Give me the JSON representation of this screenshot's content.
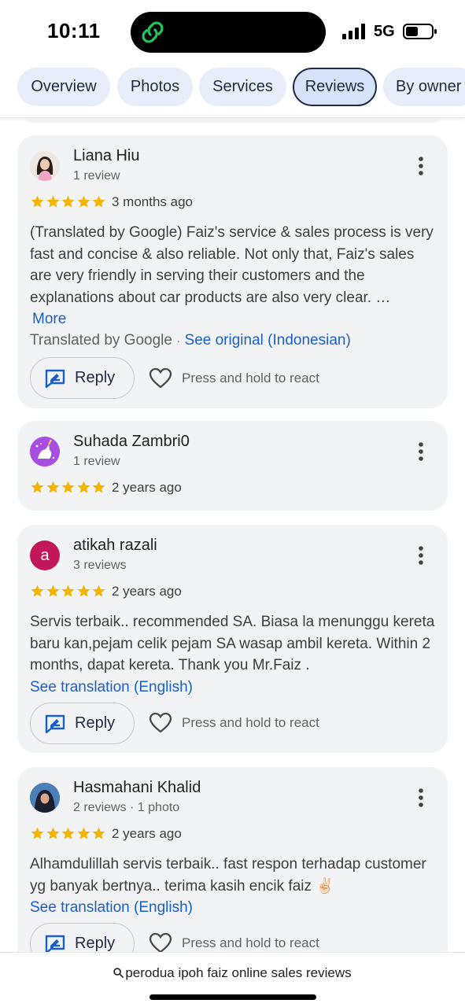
{
  "status_bar": {
    "time": "10:11",
    "network": "5G"
  },
  "tabs": [
    {
      "label": "Overview",
      "active": false
    },
    {
      "label": "Photos",
      "active": false
    },
    {
      "label": "Services",
      "active": false
    },
    {
      "label": "Reviews",
      "active": true
    },
    {
      "label": "By owner",
      "active": false
    }
  ],
  "common": {
    "reply_label": "Reply",
    "react_hint": "Press and hold to react",
    "star_color": "#f4b400",
    "link_color": "#1a5fc7"
  },
  "reviews": [
    {
      "name": "Liana Hiu",
      "meta": "1 review",
      "rating": 5,
      "time_ago": "3 months ago",
      "text": "(Translated by Google) Faiz's service & sales process is very fast and concise & also reliable. Not only that, Faiz's sales are very friendly in serving their customers and the explanations about car products are also very clear. …",
      "more_label": "More",
      "translated_by": "Translated by Google",
      "separator": "·",
      "see_original": "See original (Indonesian)"
    },
    {
      "name": "Suhada Zambri0",
      "meta": "1 review",
      "rating": 5,
      "time_ago": "2 years ago"
    },
    {
      "name": "atikah razali",
      "avatar_letter": "a",
      "avatar_color": "#c2185b",
      "meta": "3 reviews",
      "rating": 5,
      "time_ago": "2 years ago",
      "text": "Servis terbaik.. recommended SA. Biasa la menunggu kereta baru kan,pejam celik pejam SA wasap ambil kereta. Within 2 months, dapat kereta. Thank you Mr.Faiz .",
      "see_translation": "See translation (English)"
    },
    {
      "name": "Hasmahani Khalid",
      "meta": "2 reviews · 1 photo",
      "rating": 5,
      "time_ago": "2 years ago",
      "text": "Alhamdulillah servis terbaik.. fast respon terhadap customer yg banyak bertnya.. terima kasih encik faiz ✌🏻",
      "see_translation": "See translation (English)"
    }
  ],
  "bottom_bar": {
    "search_text": "perodua ipoh faiz online sales reviews"
  }
}
